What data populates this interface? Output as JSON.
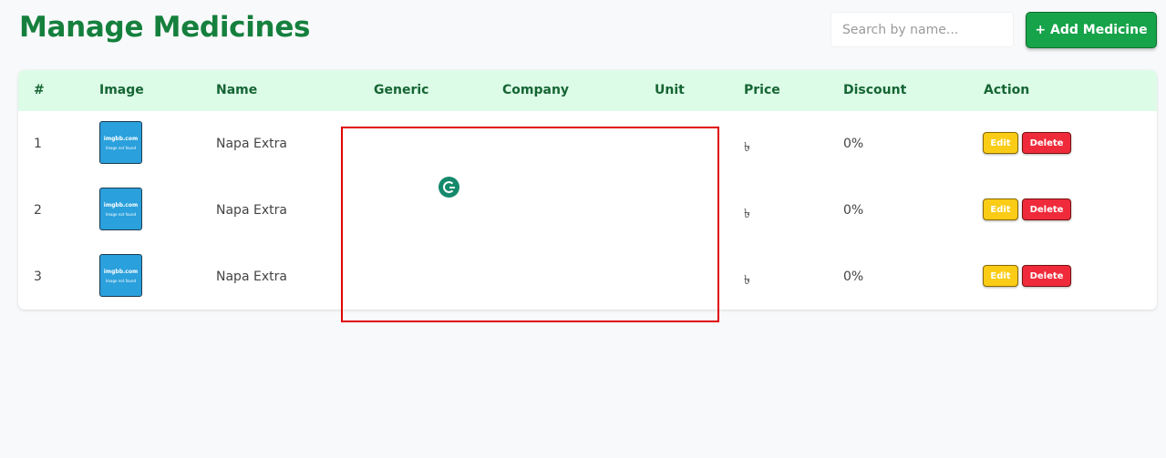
{
  "header": {
    "title": "Manage Medicines",
    "search_placeholder": "Search by name...",
    "add_button_label": "+ Add Medicine"
  },
  "table": {
    "columns": [
      "#",
      "Image",
      "Name",
      "Generic",
      "Company",
      "Unit",
      "Price",
      "Discount",
      "Action"
    ],
    "rows": [
      {
        "index": "1",
        "image_title": "imgbb.com",
        "image_sub": "Image not found",
        "name": "Napa Extra",
        "generic": "",
        "company": "",
        "unit": "",
        "price": "৳",
        "discount": "0%"
      },
      {
        "index": "2",
        "image_title": "imgbb.com",
        "image_sub": "Image not found",
        "name": "Napa Extra",
        "generic": "",
        "company": "",
        "unit": "",
        "price": "৳",
        "discount": "0%"
      },
      {
        "index": "3",
        "image_title": "imgbb.com",
        "image_sub": "Image not found",
        "name": "Napa Extra",
        "generic": "",
        "company": "",
        "unit": "",
        "price": "৳",
        "discount": "0%"
      }
    ],
    "edit_label": "Edit",
    "delete_label": "Delete"
  },
  "colors": {
    "brand_green": "#15803d",
    "header_row_bg": "#dcfce7",
    "edit_yellow": "#facc15",
    "delete_red": "#ef2b3b",
    "selection_red": "#e00000",
    "grammarly_green": "#15896b"
  },
  "icons": {
    "grammarly": "grammarly-icon"
  }
}
